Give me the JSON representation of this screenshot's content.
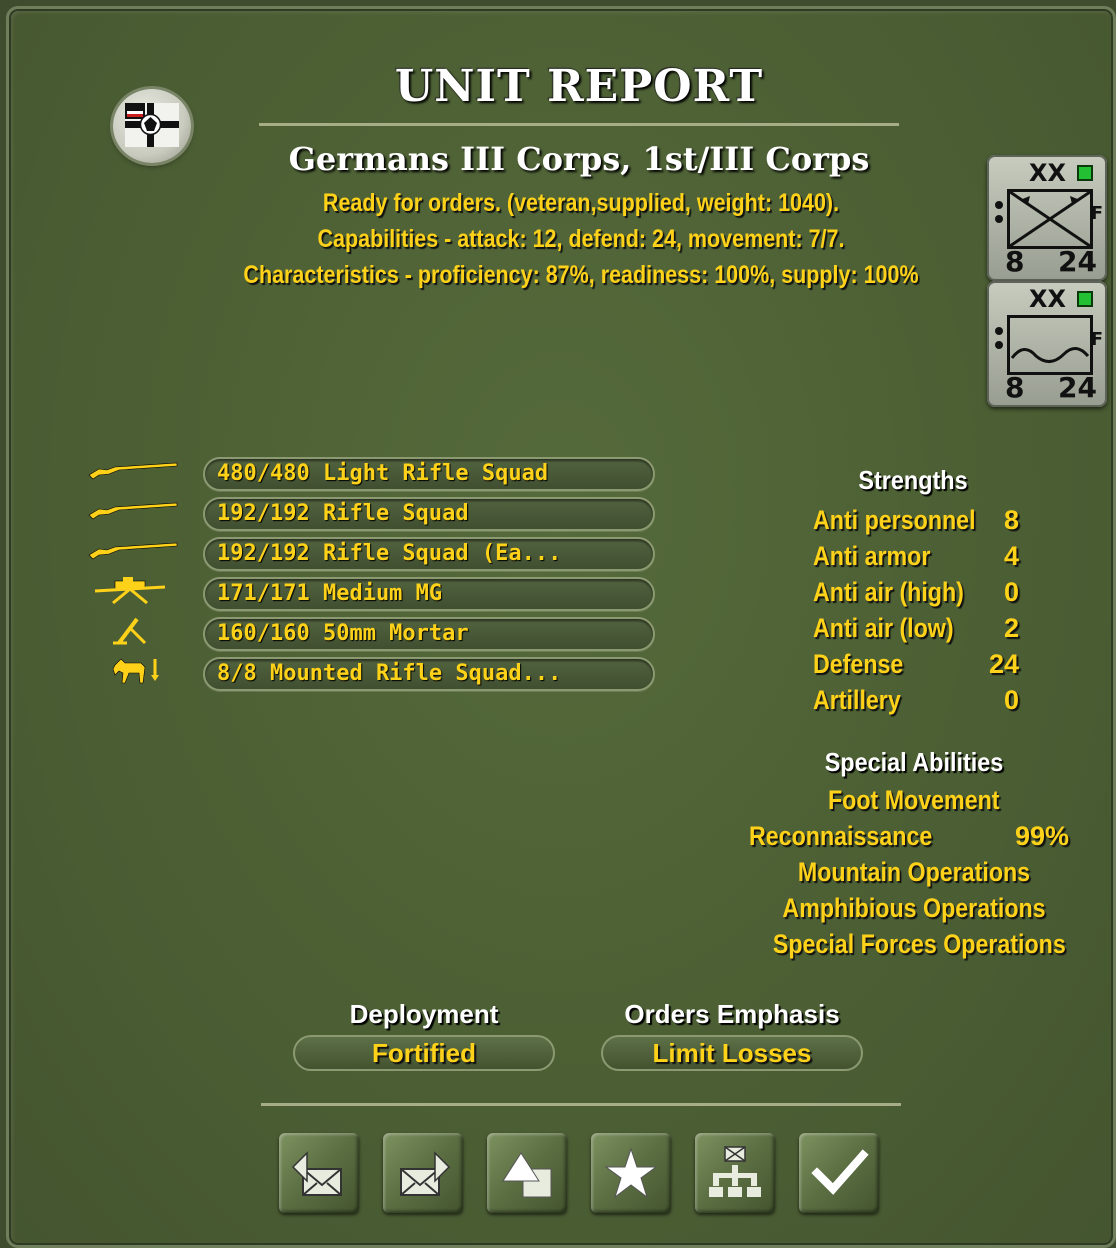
{
  "header": {
    "title": "UNIT REPORT",
    "unit_name": "Germans III Corps, 1st/III Corps",
    "status_line": "Ready for orders. (veteran,supplied, weight: 1040).",
    "capabilities_line": "Capabilities - attack: 12, defend: 24, movement: 7/7.",
    "characteristics_line": "Characteristics - proficiency: 87%, readiness: 100%, supply: 100%"
  },
  "counters": [
    {
      "size": "XX",
      "attack": "8",
      "defense": "24",
      "flag": "F",
      "type": "infantry"
    },
    {
      "size": "XX",
      "attack": "8",
      "defense": "24",
      "flag": "F",
      "type": "mountain"
    }
  ],
  "equipment": [
    {
      "icon": "rifle-icon",
      "label": "480/480 Light Rifle Squad"
    },
    {
      "icon": "rifle-icon",
      "label": "192/192 Rifle Squad"
    },
    {
      "icon": "rifle-icon",
      "label": "192/192 Rifle Squad (Ea..."
    },
    {
      "icon": "machine-gun-icon",
      "label": "171/171 Medium MG"
    },
    {
      "icon": "mortar-icon",
      "label": "160/160 50mm Mortar"
    },
    {
      "icon": "horse-icon",
      "label": "8/8 Mounted Rifle Squad..."
    }
  ],
  "strengths": {
    "heading": "Strengths",
    "rows": [
      {
        "label": "Anti personnel",
        "value": "8"
      },
      {
        "label": "Anti armor",
        "value": "4"
      },
      {
        "label": "Anti air (high)",
        "value": "0"
      },
      {
        "label": "Anti air (low)",
        "value": "2"
      },
      {
        "label": "Defense",
        "value": "24"
      },
      {
        "label": "Artillery",
        "value": "0"
      }
    ]
  },
  "special_abilities": {
    "heading": "Special Abilities",
    "items": [
      {
        "label": "Foot Movement",
        "value": ""
      },
      {
        "label": "Reconnaissance",
        "value": "99%"
      },
      {
        "label": "Mountain Operations",
        "value": ""
      },
      {
        "label": "Amphibious Operations",
        "value": ""
      },
      {
        "label": "Special Forces Operations",
        "value": ""
      }
    ]
  },
  "deployment": {
    "heading": "Deployment",
    "value": "Fortified"
  },
  "orders_emphasis": {
    "heading": "Orders Emphasis",
    "value": "Limit Losses"
  },
  "toolbar": [
    "previous-unit-icon",
    "next-unit-icon",
    "move-up-icon",
    "star-icon",
    "hierarchy-icon",
    "checkmark-icon"
  ],
  "colors": {
    "accent_yellow": "#ffd21a",
    "panel_green": "#4c5f34",
    "text_white": "#ffffff"
  }
}
